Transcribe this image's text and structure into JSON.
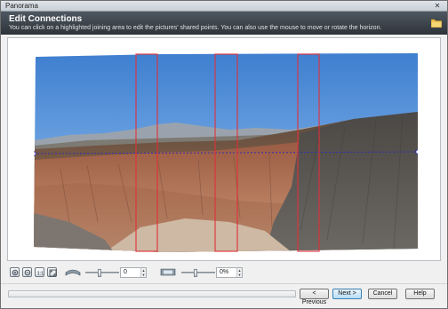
{
  "window": {
    "title": "Panorama",
    "close_label": "✕"
  },
  "header": {
    "title": "Edit Connections",
    "subtitle": "You can click on a highlighted joining area to edit the pictures' shared points. You can also use the mouse to move or rotate the horizon."
  },
  "toolbar": {
    "rotation_value": "0",
    "stretch_value": "0%",
    "rotation_level": 0.45,
    "stretch_level": 0.45,
    "spin_up": "▲",
    "spin_down": "▼"
  },
  "buttons": {
    "previous": "< Previous",
    "next": "Next >",
    "cancel": "Cancel",
    "help": "Help"
  },
  "progress": {
    "fraction": 0
  },
  "colors": {
    "accent": "#3c7fb1",
    "join_highlight": "#e0303a",
    "horizon": "#2a2ab8"
  }
}
